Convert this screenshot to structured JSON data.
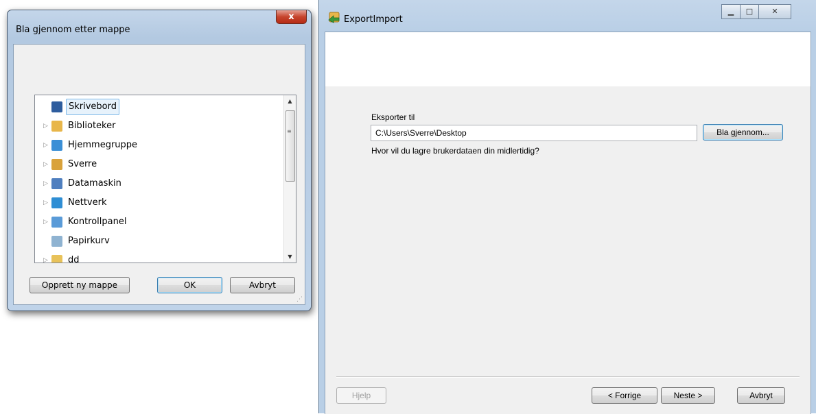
{
  "browse_dialog": {
    "title": "Bla gjennom etter mappe",
    "close_glyph": "x",
    "tree_items": [
      {
        "label": "Skrivebord",
        "icon": "desktop-icon",
        "color": "#2e5d9e",
        "selected": true,
        "expandable": false
      },
      {
        "label": "Biblioteker",
        "icon": "libraries-icon",
        "color": "#e8b64a",
        "selected": false,
        "expandable": true
      },
      {
        "label": "Hjemmegruppe",
        "icon": "homegroup-icon",
        "color": "#3b8fd6",
        "selected": false,
        "expandable": true
      },
      {
        "label": "Sverre",
        "icon": "user-folder-icon",
        "color": "#d9a23b",
        "selected": false,
        "expandable": true
      },
      {
        "label": "Datamaskin",
        "icon": "computer-icon",
        "color": "#4f7fbf",
        "selected": false,
        "expandable": true
      },
      {
        "label": "Nettverk",
        "icon": "network-icon",
        "color": "#2f8ed4",
        "selected": false,
        "expandable": true
      },
      {
        "label": "Kontrollpanel",
        "icon": "control-panel-icon",
        "color": "#5a9bd8",
        "selected": false,
        "expandable": true
      },
      {
        "label": "Papirkurv",
        "icon": "recycle-bin-icon",
        "color": "#8fb3d1",
        "selected": false,
        "expandable": false
      },
      {
        "label": "dd",
        "icon": "folder-icon",
        "color": "#e8c25a",
        "selected": false,
        "expandable": true
      }
    ],
    "new_folder_button": "Opprett ny mappe",
    "ok_button": "OK",
    "cancel_button": "Avbryt"
  },
  "main_window": {
    "title": "ExportImport",
    "export_label": "Eksporter til",
    "path_value": "C:\\Users\\Sverre\\Desktop",
    "browse_button": "Bla gjennom...",
    "question": "Hvor vil du lagre brukerdataen din midlertidig?",
    "help_button": "Hjelp",
    "back_button": "< Forrige",
    "next_button": "Neste >",
    "cancel_button": "Avbryt"
  }
}
